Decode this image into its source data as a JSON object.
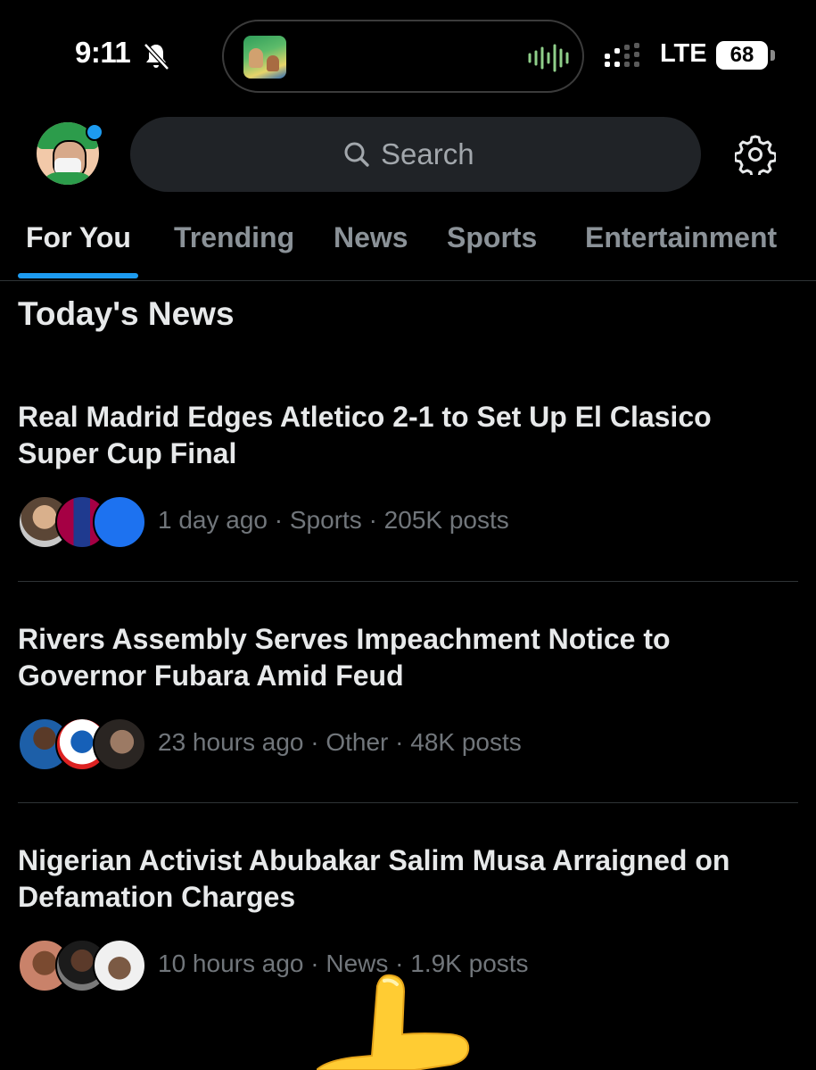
{
  "status_bar": {
    "time": "9:11",
    "network": "LTE",
    "battery": "68"
  },
  "header": {
    "search_placeholder": "Search"
  },
  "tabs": [
    {
      "label": "For You",
      "active": true
    },
    {
      "label": "Trending",
      "active": false
    },
    {
      "label": "News",
      "active": false
    },
    {
      "label": "Sports",
      "active": false
    },
    {
      "label": "Entertainment",
      "active": false
    }
  ],
  "section": {
    "title": "Today's News"
  },
  "stories": [
    {
      "title": "Real Madrid Edges Atletico 2-1 to Set Up El Clasico Super Cup Final",
      "meta": "1 day ago · Sports · 205K posts"
    },
    {
      "title": "Rivers Assembly Serves Impeachment Notice to Governor Fubara Amid Feud",
      "meta": "23 hours ago · Other · 48K posts"
    },
    {
      "title": "Nigerian Activist Abubakar Salim Musa Arraigned on Defamation Charges",
      "meta": "10 hours ago · News · 1.9K posts"
    }
  ],
  "colors": {
    "accent": "#1d9bf0",
    "background": "#000000",
    "text_primary": "#e7e9ea",
    "text_secondary": "#71767b"
  }
}
